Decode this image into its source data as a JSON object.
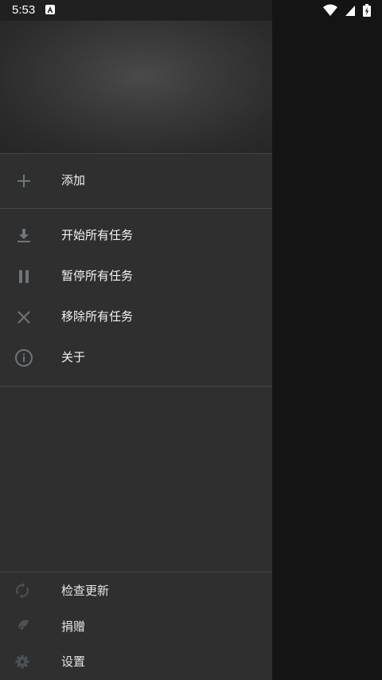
{
  "status_bar": {
    "time": "5:53",
    "notification_icon": "app-notification-icon",
    "wifi_icon": "wifi-icon",
    "signal_icon": "cell-signal-icon",
    "battery_icon": "battery-charging-icon"
  },
  "drawer": {
    "add_section": {
      "items": [
        {
          "label": "添加",
          "icon": "plus-icon"
        }
      ]
    },
    "task_section": {
      "items": [
        {
          "label": "开始所有任务",
          "icon": "download-icon"
        },
        {
          "label": "暂停所有任务",
          "icon": "pause-icon"
        },
        {
          "label": "移除所有任务",
          "icon": "close-icon"
        },
        {
          "label": "关于",
          "icon": "info-icon"
        }
      ]
    },
    "footer": {
      "items": [
        {
          "label": "检查更新",
          "icon": "sync-icon"
        },
        {
          "label": "捐赠",
          "icon": "donate-feather-icon"
        },
        {
          "label": "设置",
          "icon": "gear-icon"
        }
      ]
    }
  },
  "colors": {
    "drawer_background": "#2f2f2f",
    "scrim_background": "#141414",
    "icon_color": "#6e767c",
    "text_color": "#f2f2f2"
  }
}
